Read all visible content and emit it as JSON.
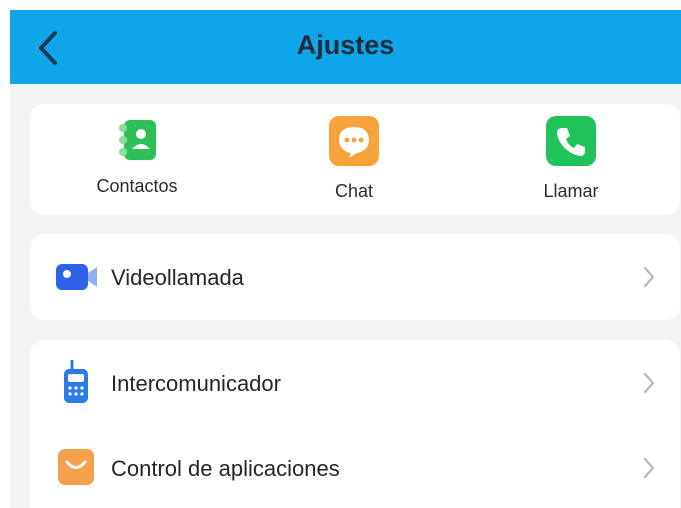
{
  "header": {
    "title": "Ajustes",
    "back_icon": "chevron-left-icon",
    "background": "#0ea5e9"
  },
  "quick_actions": [
    {
      "label": "Contactos",
      "icon": "contacts-icon",
      "color": "#3cc85f"
    },
    {
      "label": "Chat",
      "icon": "chat-bubble-icon",
      "color": "#f7a23b"
    },
    {
      "label": "Llamar",
      "icon": "phone-icon",
      "color": "#1fc35a"
    }
  ],
  "menu": {
    "video_call": {
      "label": "Videollamada",
      "icon": "video-camera-icon",
      "color": "#2f62e9"
    },
    "intercom": {
      "label": "Intercomunicador",
      "icon": "walkie-talkie-icon",
      "color": "#2b7be8"
    },
    "app_control": {
      "label": "Control de aplicaciones",
      "icon": "shopping-bag-icon",
      "color": "#f5a04a"
    }
  }
}
